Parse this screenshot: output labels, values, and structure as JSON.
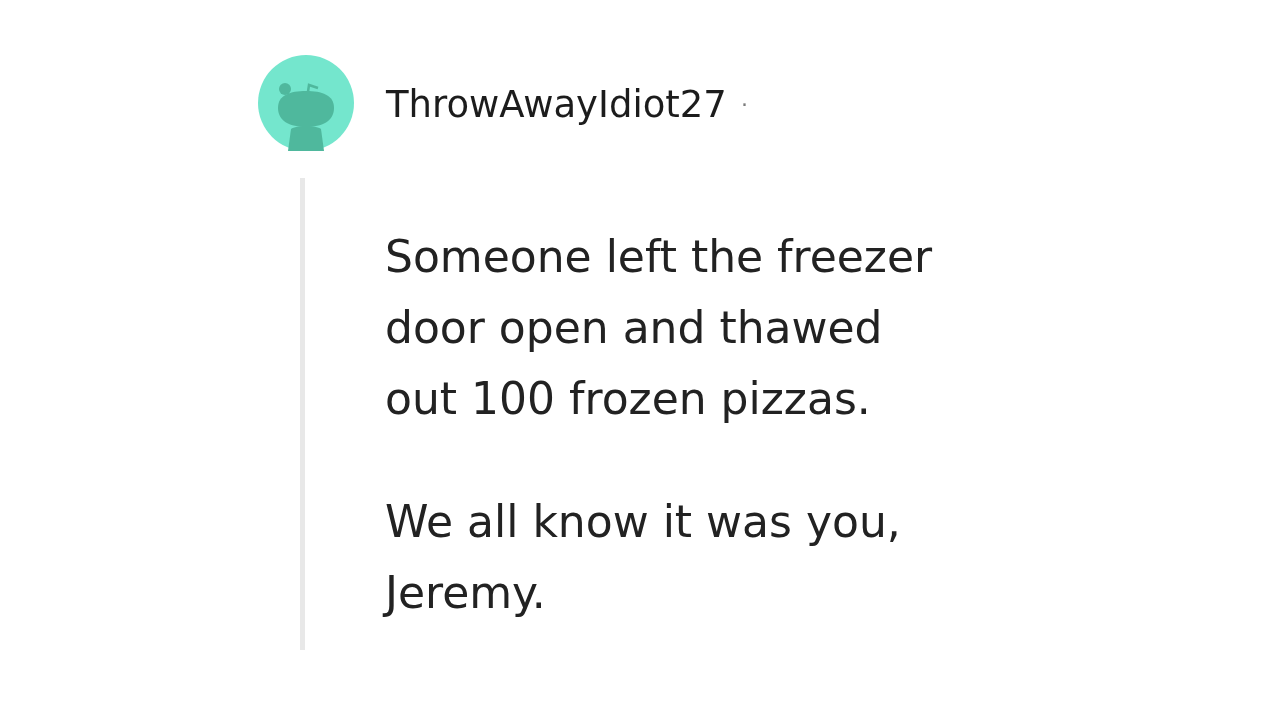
{
  "comment": {
    "author": "ThrowAwayIdiot27",
    "separator": "·",
    "paragraphs": [
      "Someone left the freezer door open and thawed out 100 frozen pizzas.",
      "We all know it was you, Jeremy."
    ]
  }
}
